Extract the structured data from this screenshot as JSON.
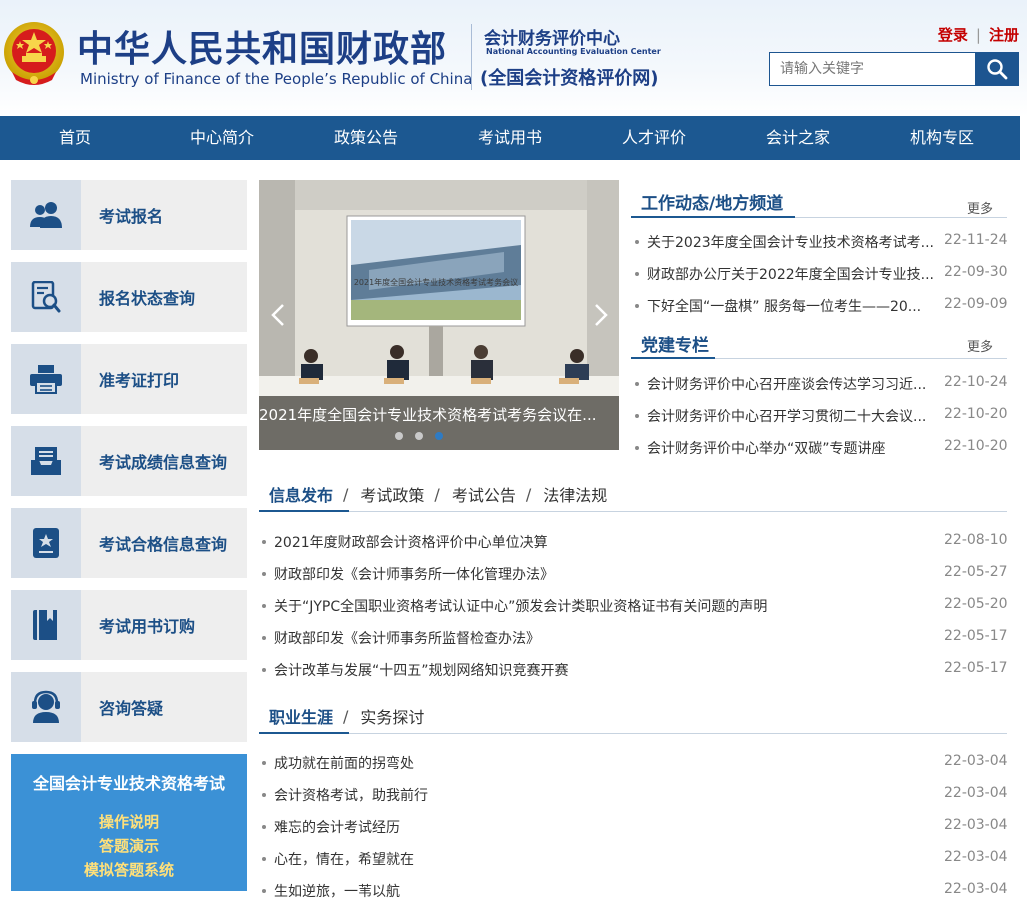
{
  "header": {
    "site_title_cn": "中华人民共和国财政部",
    "site_title_en": "Ministry of Finance of the People’s Republic of China",
    "center_name_cn": "会计财务评价中心",
    "center_name_en": "National Accounting Evaluation Center",
    "center_net": "(全国会计资格评价网)",
    "login_label": "登录",
    "register_label": "注册",
    "search_placeholder": "请输入关键字"
  },
  "nav": [
    {
      "label": "首页"
    },
    {
      "label": "中心简介"
    },
    {
      "label": "政策公告"
    },
    {
      "label": "考试用书"
    },
    {
      "label": "人才评价"
    },
    {
      "label": "会计之家"
    },
    {
      "label": "机构专区"
    }
  ],
  "sidebar": {
    "items": [
      {
        "label": "考试报名",
        "icon": "users-icon"
      },
      {
        "label": "报名状态查询",
        "icon": "document-search-icon"
      },
      {
        "label": "准考证打印",
        "icon": "printer-icon"
      },
      {
        "label": "考试成绩信息查询",
        "icon": "inbox-icon"
      },
      {
        "label": "考试合格信息查询",
        "icon": "certificate-icon"
      },
      {
        "label": "考试用书订购",
        "icon": "book-icon"
      },
      {
        "label": "咨询答疑",
        "icon": "headset-icon"
      }
    ],
    "exam_banner": {
      "title": "全国会计专业技术资格考试",
      "links": [
        "操作说明",
        "答题演示",
        "模拟答题系统"
      ]
    }
  },
  "carousel": {
    "caption": "2021年度全国会计专业技术资格考试考务会议在...",
    "screen_text": "2021年度全国会计专业技术资格考试考务会议",
    "slide_count": 3,
    "active_index": 2
  },
  "work_news": {
    "title": "工作动态/地方频道",
    "more": "更多",
    "items": [
      {
        "text": "关于2023年度全国会计专业技术资格考试考...",
        "date": "22-11-24"
      },
      {
        "text": "财政部办公厅关于2022年度全国会计专业技...",
        "date": "22-09-30"
      },
      {
        "text": "下好全国“一盘棋” 服务每一位考生——20...",
        "date": "22-09-09"
      }
    ]
  },
  "party": {
    "title": "党建专栏",
    "more": "更多",
    "items": [
      {
        "text": "会计财务评价中心召开座谈会传达学习习近...",
        "date": "22-10-24"
      },
      {
        "text": "会计财务评价中心召开学习贯彻二十大会议...",
        "date": "22-10-20"
      },
      {
        "text": "会计财务评价中心举办“双碳”专题讲座",
        "date": "22-10-20"
      }
    ]
  },
  "info": {
    "tabs": [
      "信息发布",
      "考试政策",
      "考试公告",
      "法律法规"
    ],
    "items": [
      {
        "text": "2021年度财政部会计资格评价中心单位决算",
        "date": "22-08-10"
      },
      {
        "text": "财政部印发《会计师事务所一体化管理办法》",
        "date": "22-05-27"
      },
      {
        "text": "关于“JYPC全国职业资格考试认证中心”颁发会计类职业资格证书有关问题的声明",
        "date": "22-05-20"
      },
      {
        "text": "财政部印发《会计师事务所监督检查办法》",
        "date": "22-05-17"
      },
      {
        "text": "会计改革与发展“十四五”规划网络知识竞赛开赛",
        "date": "22-05-17"
      }
    ]
  },
  "career": {
    "tabs": [
      "职业生涯",
      "实务探讨"
    ],
    "items": [
      {
        "text": "成功就在前面的拐弯处",
        "date": "22-03-04"
      },
      {
        "text": "会计资格考试，助我前行",
        "date": "22-03-04"
      },
      {
        "text": "难忘的会计考试经历",
        "date": "22-03-04"
      },
      {
        "text": "心在，情在，希望就在",
        "date": "22-03-04"
      },
      {
        "text": "生如逆旅，一苇以航",
        "date": "22-03-04"
      }
    ]
  },
  "colors": {
    "brand_blue": "#1c5891",
    "title_blue": "#1d3f86",
    "login_red": "#c40000",
    "banner_blue": "#3b91d6",
    "banner_link": "#ffe07a"
  }
}
